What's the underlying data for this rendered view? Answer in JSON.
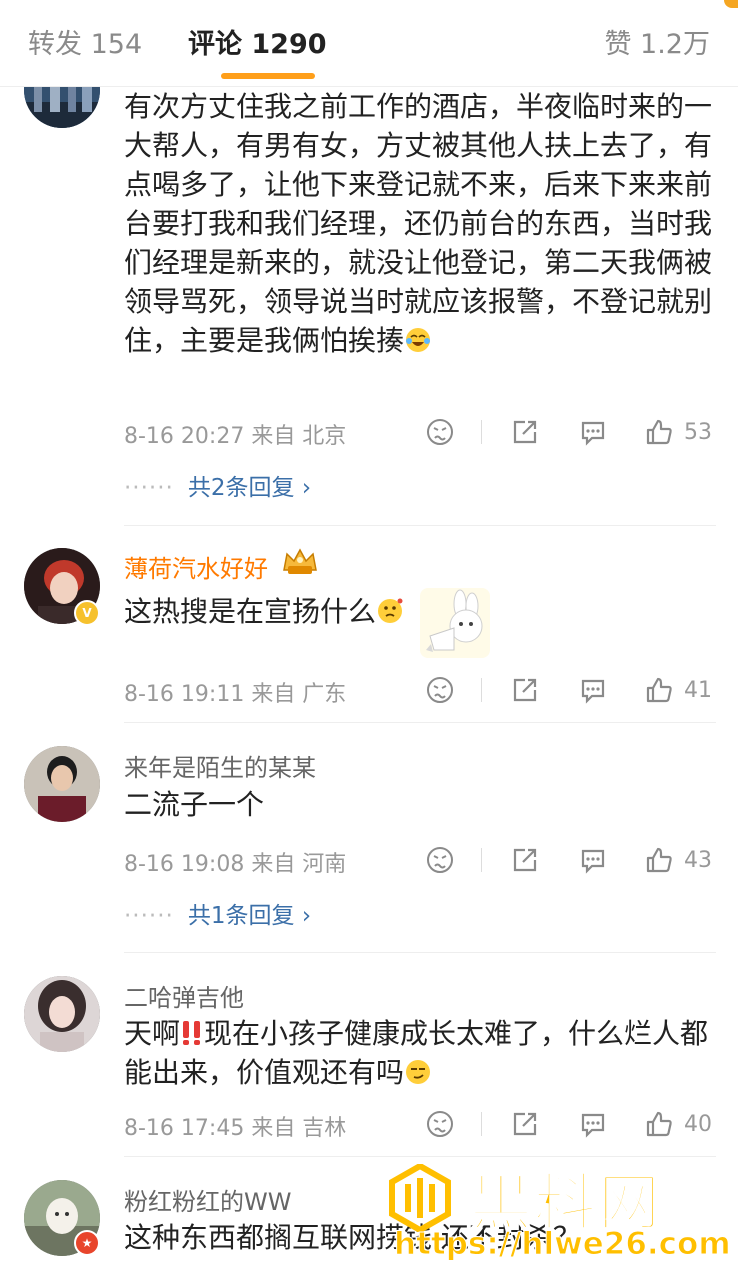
{
  "tabs": {
    "repost": "转发 154",
    "comments": "评论 1290",
    "likes": "赞 1.2万"
  },
  "comments": [
    {
      "text": "有次方丈住我之前工作的酒店，半夜临时来的一大帮人，有男有女，方丈被其他人扶上去了，有点喝多了，让他下来登记就不来，后来下来来前台要打我和我们经理，还仍前台的东西，当时我们经理是新来的，就没让他登记，第二天我俩被领导骂死，领导说当时就应该报警，不登记就别住，主要是我俩怕挨揍",
      "meta": "8-16 20:27  来自 北京",
      "likes": "53",
      "replies": "共2条回复"
    },
    {
      "name": "薄荷汽水好好",
      "text": "这热搜是在宣扬什么",
      "meta": "8-16 19:11  来自 广东",
      "likes": "41"
    },
    {
      "name": "来年是陌生的某某",
      "text": "二流子一个",
      "meta": "8-16 19:08  来自 河南",
      "likes": "43",
      "replies": "共1条回复"
    },
    {
      "name": "二哈弹吉他",
      "text_a": "天啊",
      "text_b": "现在小孩子健康成长太难了，什么烂人都能出来，价值观还有吗",
      "meta": "8-16 17:45  来自 吉林",
      "likes": "40"
    },
    {
      "name": "粉红粉红的WW",
      "text": "这种东西都搁互联网捞钱 还不封杀？"
    }
  ],
  "watermark": {
    "name": "黑料网",
    "url": "https://hlwe26.com"
  },
  "colors": {
    "accent": "#ff9f1a",
    "vip_name": "#ff7a00",
    "link": "#3b6fa8",
    "watermark": "#ffbf00"
  },
  "icons": [
    "dislike-icon",
    "share-icon",
    "comment-icon",
    "like-icon",
    "verified-badge-icon",
    "vip-crown-icon",
    "chevron-right-icon"
  ]
}
